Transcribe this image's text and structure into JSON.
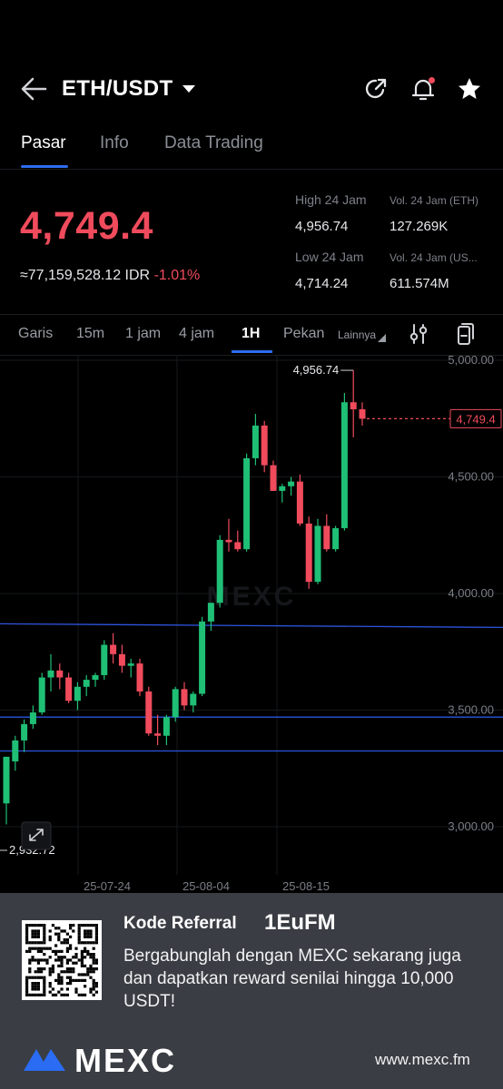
{
  "header": {
    "pair": "ETH/USDT",
    "icons": [
      "back-icon",
      "share-icon",
      "alert-bell-icon",
      "favorite-star-icon"
    ]
  },
  "tabs": [
    {
      "label": "Pasar",
      "active": true
    },
    {
      "label": "Info",
      "active": false
    },
    {
      "label": "Data Trading",
      "active": false
    }
  ],
  "price": {
    "last": "4,749.4",
    "idr": "≈77,159,528.12 IDR",
    "change": "-1.01%",
    "color_down": "#f04b5c"
  },
  "stats": {
    "high_label": "High 24 Jam",
    "high_value": "4,956.74",
    "vol_eth_label": "Vol. 24 Jam (ETH)",
    "vol_eth_value": "127.269K",
    "low_label": "Low 24 Jam",
    "low_value": "4,714.24",
    "vol_usdt_label": "Vol. 24 Jam (US...",
    "vol_usdt_value": "611.574M"
  },
  "timeframes": [
    {
      "label": "Garis",
      "active": false
    },
    {
      "label": "15m",
      "active": false
    },
    {
      "label": "1 jam",
      "active": false
    },
    {
      "label": "4 jam",
      "active": false
    },
    {
      "label": "1H",
      "active": true
    },
    {
      "label": "Pekan",
      "active": false
    },
    {
      "label": "Lainnya",
      "active": false
    }
  ],
  "chart_data": {
    "type": "candlestick",
    "y_ticks": [
      "5,000.00",
      "4,500.00",
      "4,000.00",
      "3,500.00",
      "3,000.00"
    ],
    "y_tick_values": [
      5000,
      4500,
      4000,
      3500,
      3000
    ],
    "x_ticks": [
      "25-07-24",
      "25-08-04",
      "25-08-15"
    ],
    "high_marker": "4,956.74",
    "low_marker": "2,932.72",
    "last_price_label": "4,749.4",
    "last_price": 4749.4,
    "horizontal_lines": [
      3870,
      3470,
      3325
    ],
    "watermark": "MEXC",
    "colors": {
      "up": "#1fbf75",
      "down": "#f04b5c",
      "line": "#2d55e0"
    },
    "candles": [
      [
        3100,
        3300,
        3010,
        3300
      ],
      [
        3280,
        3390,
        3240,
        3370
      ],
      [
        3370,
        3460,
        3320,
        3440
      ],
      [
        3440,
        3520,
        3420,
        3490
      ],
      [
        3490,
        3660,
        3480,
        3640
      ],
      [
        3640,
        3740,
        3580,
        3670
      ],
      [
        3670,
        3700,
        3590,
        3640
      ],
      [
        3640,
        3660,
        3530,
        3540
      ],
      [
        3540,
        3620,
        3500,
        3600
      ],
      [
        3600,
        3650,
        3560,
        3630
      ],
      [
        3630,
        3660,
        3600,
        3650
      ],
      [
        3650,
        3800,
        3630,
        3780
      ],
      [
        3780,
        3830,
        3700,
        3740
      ],
      [
        3740,
        3780,
        3660,
        3690
      ],
      [
        3690,
        3720,
        3640,
        3700
      ],
      [
        3700,
        3720,
        3560,
        3580
      ],
      [
        3580,
        3600,
        3390,
        3400
      ],
      [
        3400,
        3480,
        3350,
        3390
      ],
      [
        3390,
        3480,
        3350,
        3470
      ],
      [
        3470,
        3600,
        3450,
        3590
      ],
      [
        3590,
        3620,
        3500,
        3520
      ],
      [
        3520,
        3580,
        3490,
        3570
      ],
      [
        3570,
        3900,
        3560,
        3880
      ],
      [
        3880,
        3960,
        3840,
        3960
      ],
      [
        3960,
        4250,
        3940,
        4230
      ],
      [
        4230,
        4320,
        4180,
        4220
      ],
      [
        4220,
        4270,
        4180,
        4190
      ],
      [
        4190,
        4600,
        4180,
        4580
      ],
      [
        4580,
        4770,
        4550,
        4720
      ],
      [
        4720,
        4740,
        4520,
        4550
      ],
      [
        4550,
        4570,
        4440,
        4440
      ],
      [
        4440,
        4470,
        4390,
        4460
      ],
      [
        4460,
        4500,
        4420,
        4480
      ],
      [
        4480,
        4510,
        4290,
        4300
      ],
      [
        4300,
        4330,
        4020,
        4050
      ],
      [
        4050,
        4320,
        4040,
        4290
      ],
      [
        4290,
        4340,
        4180,
        4190
      ],
      [
        4190,
        4290,
        4180,
        4280
      ],
      [
        4280,
        4860,
        4270,
        4820
      ],
      [
        4820,
        4957,
        4670,
        4790
      ],
      [
        4790,
        4820,
        4720,
        4749.4
      ]
    ]
  },
  "referral": {
    "label": "Kode Referral",
    "code": "1EuFM",
    "text": "Bergabunglah dengan MEXC sekarang juga dan dapatkan reward senilai hingga 10,000 USDT!",
    "brand": "MEXC",
    "url": "www.mexc.fm"
  }
}
